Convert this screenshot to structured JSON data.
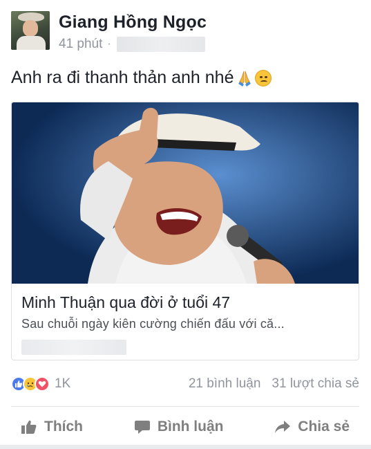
{
  "post": {
    "author": "Giang Hồng Ngọc",
    "time": "41 phút",
    "separator": "·",
    "status_text": "Anh ra đi thanh thản anh nhé",
    "status_emojis": [
      "folded-hands-icon",
      "disappointed-face-icon"
    ]
  },
  "link_preview": {
    "title": "Minh Thuận qua đời ở tuổi 47",
    "description": "Sau chuỗi ngày kiên cường chiến đấu với că..."
  },
  "reactions": {
    "types": [
      "like",
      "sad",
      "love"
    ],
    "count": "1K",
    "comments": "21 bình luận",
    "shares": "31 lượt chia sẻ"
  },
  "actions": {
    "like_label": "Thích",
    "comment_label": "Bình luận",
    "share_label": "Chia sẻ"
  },
  "colors": {
    "author_text": "#1d2129",
    "meta_text": "#90949c",
    "action_text": "#7f7f7f",
    "like_blue": "#4b7bec",
    "love_red": "#f25268",
    "sad_yellow": "#f7c43a"
  }
}
